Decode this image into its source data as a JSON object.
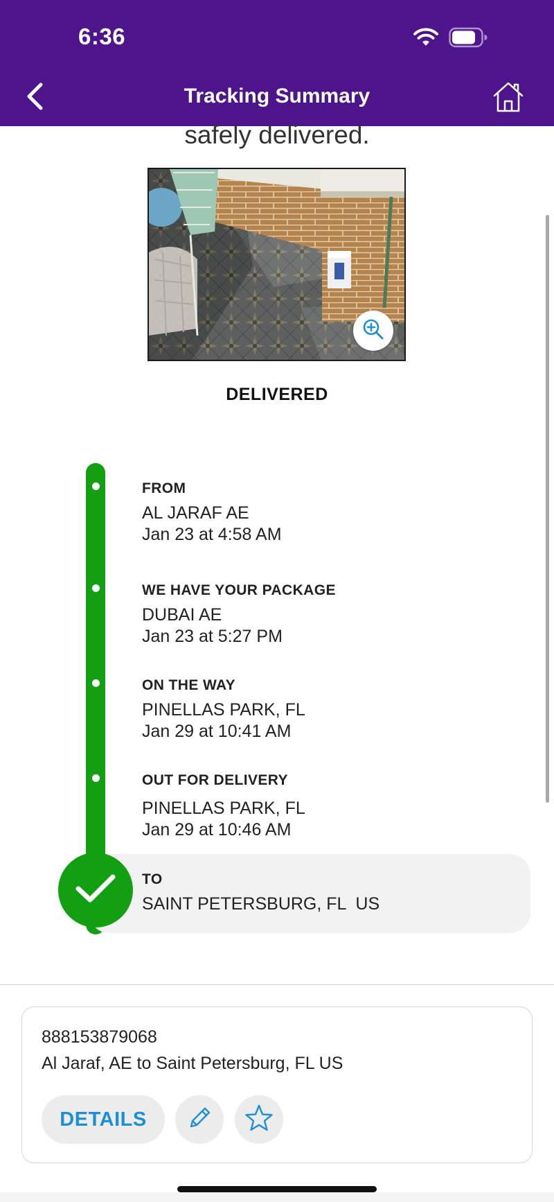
{
  "status_bar": {
    "time": "6:36"
  },
  "header": {
    "title": "Tracking Summary"
  },
  "content": {
    "delivered_message": "safely delivered.",
    "status": "DELIVERED"
  },
  "timeline": [
    {
      "label": "FROM",
      "location": "AL JARAF AE",
      "datetime": "Jan 23 at 4:58 AM"
    },
    {
      "label": "WE HAVE YOUR PACKAGE",
      "location": "DUBAI AE",
      "datetime": "Jan 23 at 5:27 PM"
    },
    {
      "label": "ON THE WAY",
      "location": "PINELLAS PARK, FL",
      "datetime": "Jan 29 at 10:41 AM"
    },
    {
      "label": "OUT FOR DELIVERY",
      "location": "PINELLAS PARK, FL",
      "datetime": "Jan 29 at 10:46 AM"
    },
    {
      "label": "TO",
      "location": "SAINT PETERSBURG, FL  US"
    }
  ],
  "card": {
    "tracking_number": "888153879068",
    "route": "Al Jaraf, AE to Saint Petersburg, FL US",
    "details_label": "DETAILS"
  },
  "icons": {
    "back": "chevron-left-icon",
    "home": "home-icon",
    "zoom": "zoom-in-icon",
    "check": "checkmark-icon",
    "edit": "pencil-icon",
    "watch": "star-icon"
  },
  "colors": {
    "header": "#4d148c",
    "timeline": "#12a012",
    "link": "#1d8fd6"
  }
}
